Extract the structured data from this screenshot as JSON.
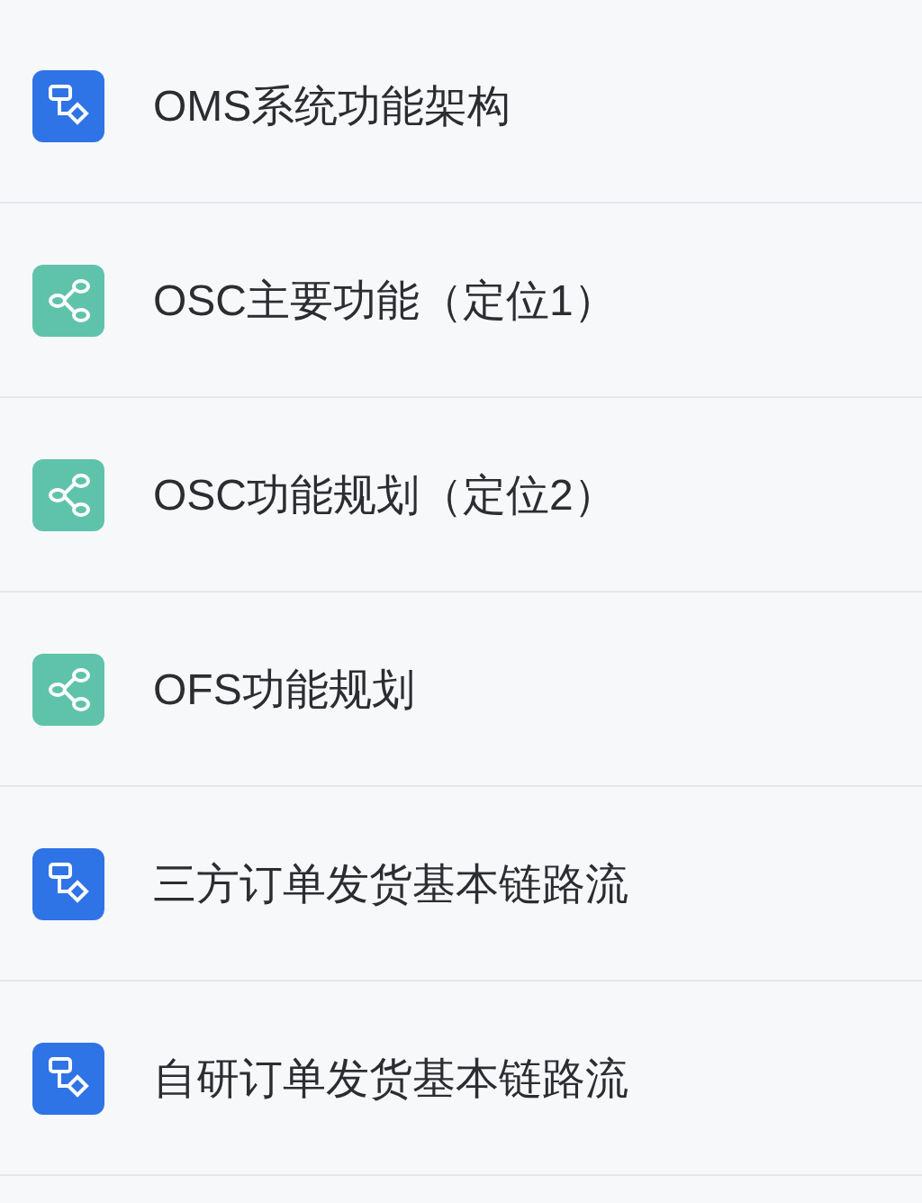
{
  "documents": [
    {
      "title": "OMS系统功能架构",
      "kind": "flowchart"
    },
    {
      "title": "OSC主要功能（定位1）",
      "kind": "mindmap"
    },
    {
      "title": "OSC功能规划（定位2）",
      "kind": "mindmap"
    },
    {
      "title": "OFS功能规划",
      "kind": "mindmap"
    },
    {
      "title": "三方订单发货基本链路流",
      "kind": "flowchart"
    },
    {
      "title": "自研订单发货基本链路流",
      "kind": "flowchart"
    }
  ]
}
